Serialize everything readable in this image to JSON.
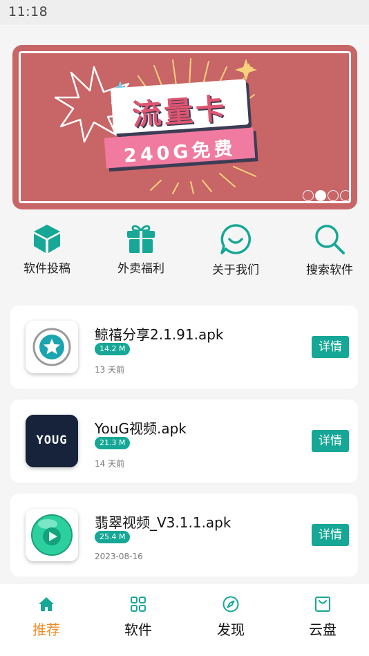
{
  "status_bar": {
    "time": "11:18"
  },
  "banner": {
    "title": "流量卡",
    "subtitle": "240G免费",
    "slide_count": 4,
    "active_slide": 2
  },
  "quick_nav": [
    {
      "label": "软件投稿",
      "icon": "cube-icon"
    },
    {
      "label": "外卖福利",
      "icon": "gift-icon"
    },
    {
      "label": "关于我们",
      "icon": "chat-icon"
    },
    {
      "label": "搜索软件",
      "icon": "search-icon"
    }
  ],
  "apps": [
    {
      "name": "鲸禧分享2.1.91.apk",
      "size": "14.2 M",
      "date": "13 天前",
      "action": "详情",
      "icon": "star-icon"
    },
    {
      "name": "YouG视频.apk",
      "size": "21.3 M",
      "date": "14 天前",
      "action": "详情",
      "icon": "youg-logo-icon",
      "icon_text": "YOUG"
    },
    {
      "name": "翡翠视频_V3.1.1.apk",
      "size": "25.4 M",
      "date": "2023-08-16",
      "action": "详情",
      "icon": "play-orb-icon"
    }
  ],
  "bottom_nav": [
    {
      "label": "推荐",
      "icon": "home-icon",
      "active": true
    },
    {
      "label": "软件",
      "icon": "grid-icon",
      "active": false
    },
    {
      "label": "发现",
      "icon": "compass-icon",
      "active": false
    },
    {
      "label": "云盘",
      "icon": "bag-icon",
      "active": false
    }
  ],
  "colors": {
    "accent": "#16a796",
    "active_tab": "#f08a25",
    "banner_bg": "#c86566",
    "banner_title": "#e05570"
  }
}
